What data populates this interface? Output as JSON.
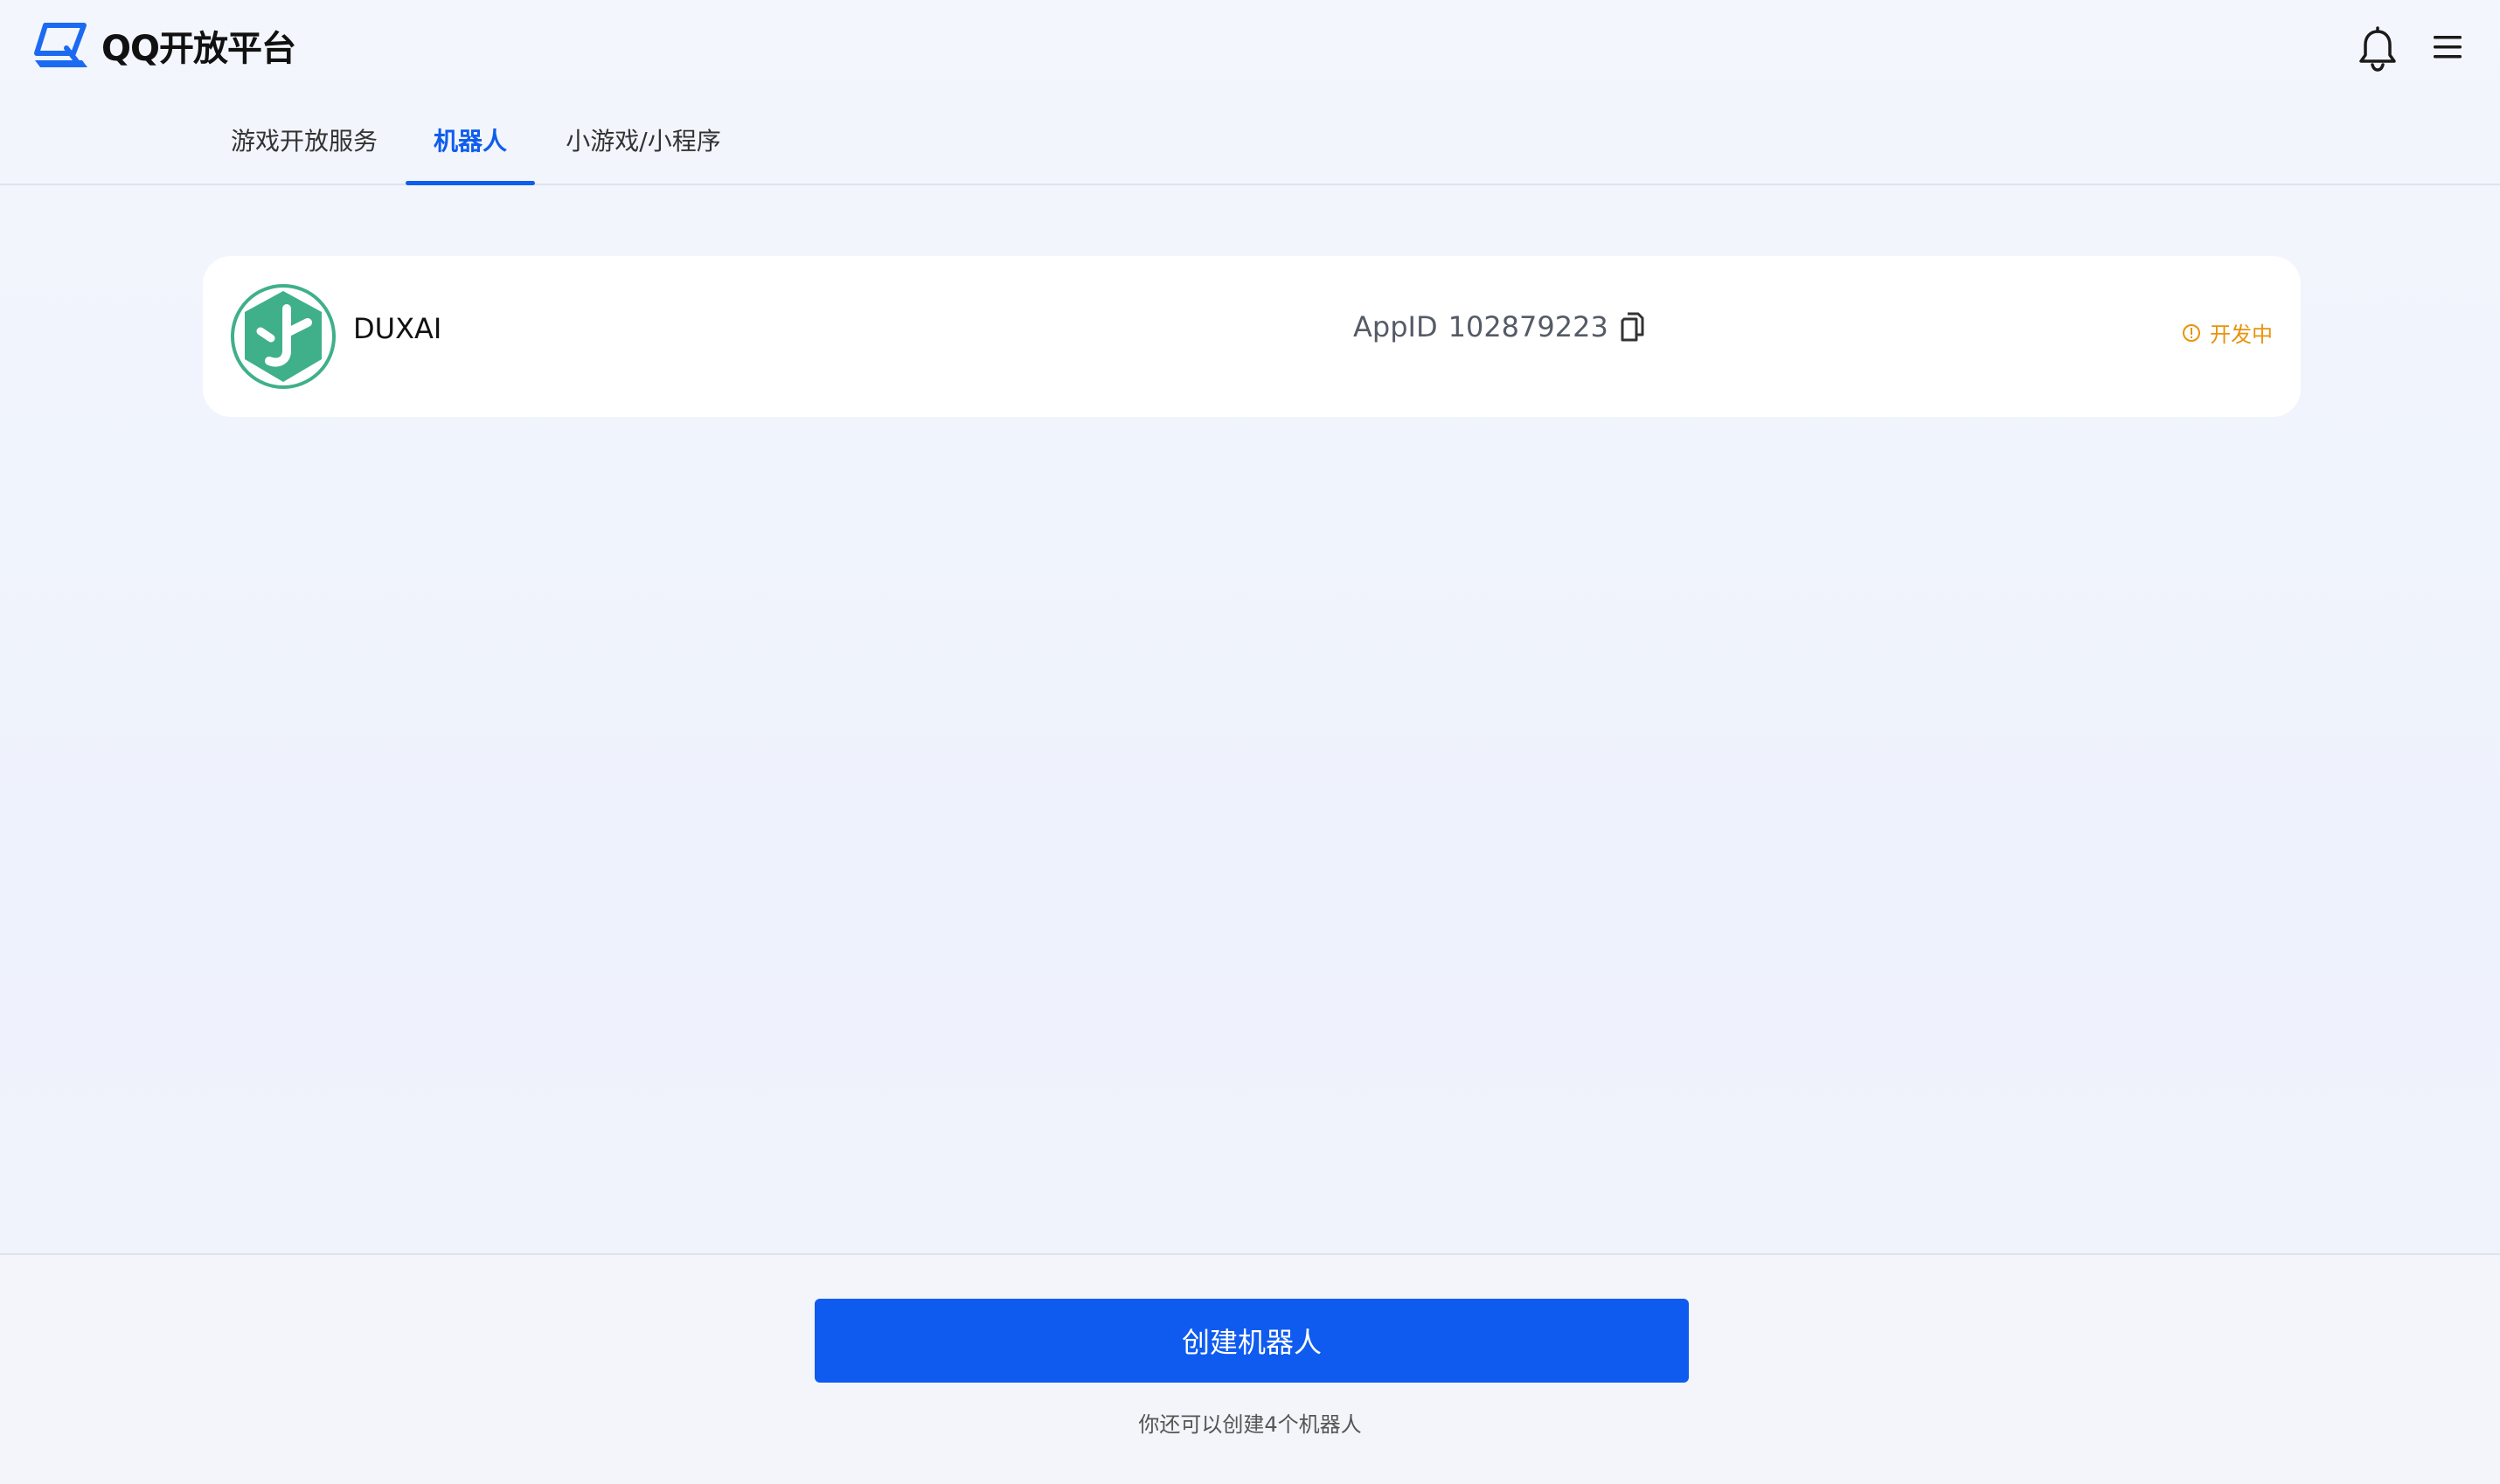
{
  "header": {
    "logo_text": "QQ开放平台",
    "icons": [
      "logo-icon",
      "bell-icon",
      "menu-icon"
    ]
  },
  "tabs": [
    {
      "label": "游戏开放服务",
      "active": false
    },
    {
      "label": "机器人",
      "active": true
    },
    {
      "label": "小游戏/小程序",
      "active": false
    }
  ],
  "bot": {
    "name": "DUXAI",
    "appid_label": "AppID",
    "appid": "102879223",
    "status": "开发中"
  },
  "footer": {
    "create_label": "创建机器人",
    "hint": "你还可以创建4个机器人"
  },
  "colors": {
    "accent": "#0f5ded",
    "status": "#e8930c",
    "avatar": "#3fb08a"
  }
}
